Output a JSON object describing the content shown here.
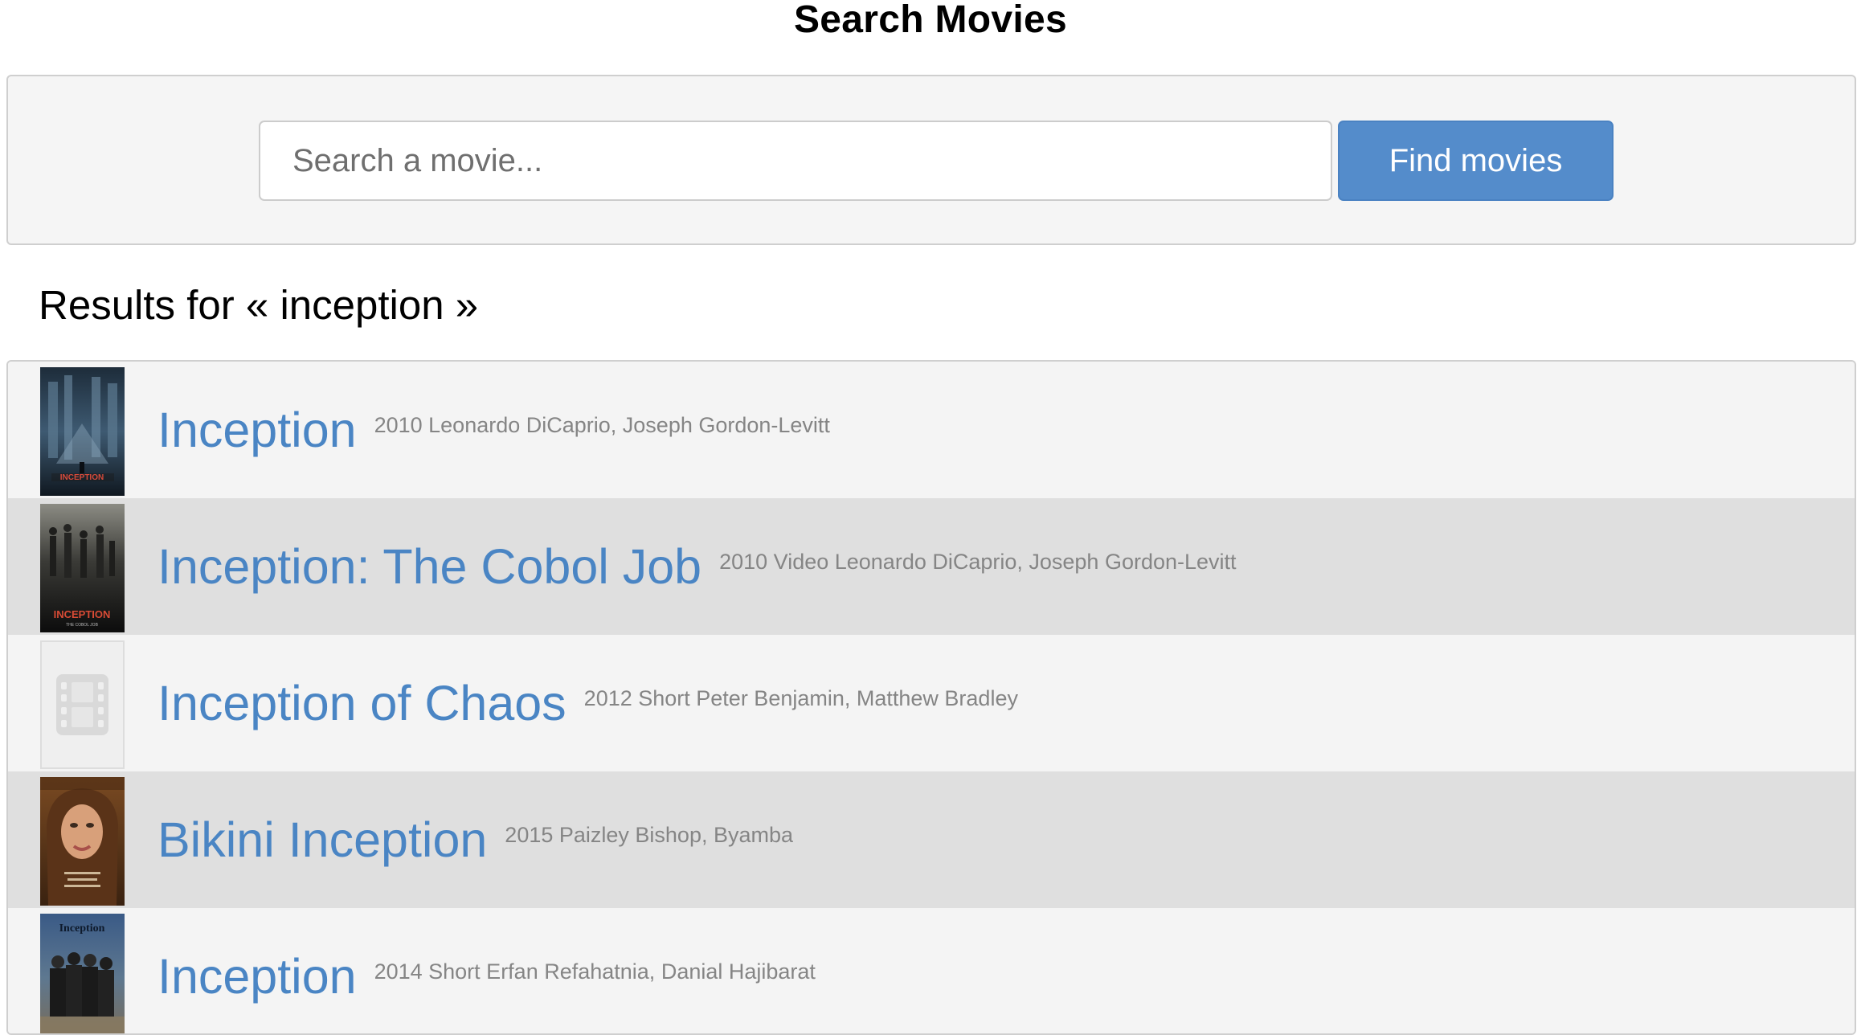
{
  "page": {
    "title": "Search Movies"
  },
  "search": {
    "placeholder": "Search a movie...",
    "value": "",
    "button_label": "Find movies"
  },
  "results": {
    "heading": "Results for « inception »",
    "items": [
      {
        "title": "Inception",
        "year": "2010",
        "meta": "2010 Leonardo DiCaprio, Joseph Gordon-Levitt",
        "poster": "inception-2010-poster"
      },
      {
        "title": "Inception: The Cobol Job",
        "year": "2010",
        "meta": "2010 Video Leonardo DiCaprio, Joseph Gordon-Levitt",
        "poster": "inception-cobol-job-poster",
        "poster_text": "INCEPTION",
        "poster_subtext": "THE COBOL JOB"
      },
      {
        "title": "Inception of Chaos",
        "year": "2012",
        "meta": "2012 Short Peter Benjamin, Matthew Bradley",
        "poster": "film-placeholder-icon"
      },
      {
        "title": "Bikini Inception",
        "year": "2015",
        "meta": "2015 Paizley Bishop, Byamba",
        "poster": "bikini-inception-poster"
      },
      {
        "title": "Inception",
        "year": "2014",
        "meta": "2014 Short Erfan Refahatnia, Danial Hajibarat",
        "poster": "inception-2014-poster",
        "poster_text": "Inception"
      }
    ]
  },
  "colors": {
    "link": "#4a85c4",
    "button": "#548ccb",
    "row_alt": "#dfdfdf",
    "row": "#f4f4f4",
    "meta": "#858585"
  }
}
